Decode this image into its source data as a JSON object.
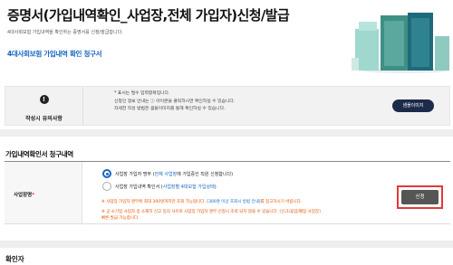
{
  "page": {
    "title": "증명서(가입내역확인_사업장,전체 가입자)신청/발급",
    "subtitle": "4대사회보험 가입내역을 확인하는 증명서를 신청/발급합니다.",
    "link_title": "4대사회보험 가입내역 확인 청구서"
  },
  "notice": {
    "label": "작성시 유의사항",
    "lines": [
      "* 표시는 필수 입력항목입니다.",
      "신청인 정보 안내는 ⓘ 아이콘을 클릭하시면 확인하실 수 있습니다.",
      "자세한 작성 방법은 샘플이미지를 통해 확인하실 수 있습니다."
    ],
    "sample_button": "샘플이미지"
  },
  "section": {
    "title": "가입내역확인서 청구내역",
    "row_label": "사업장명",
    "required_mark": "*",
    "options": [
      {
        "prefix": "사업장 가입자 명부 (",
        "link": "전체 사업장",
        "suffix": "에 가입중인 직원 신청합니다)",
        "selected": true
      },
      {
        "prefix": "사업장 가입내역 확인서 (",
        "link": "사업장별 4대보험 가입상태",
        "suffix": ")",
        "selected": false
      }
    ],
    "warning1_prefix": "※ 사업장 가입자 명부에 최대 300명까지만 조회 가능합니다.  ",
    "warning1_link": "[300명 이상 조회시 방법 안내]",
    "warning1_suffix": "를 참고하시기 바랍니다.",
    "warning2_line1": "※ 공·소기업 사업자 중 소재지 신고 등의 사유로 사업장 가입자 명부 신청시 조회 되지 않을 수 있습니다.  [신규/휴업/폐업 사업장]",
    "warning2_line2": "빠른 발급 가능합니다.",
    "apply_button": "신청"
  },
  "confirm": {
    "title": "확인자"
  },
  "colors": {
    "accent_blue": "#1565c0",
    "warning_orange": "#e65100",
    "highlight_red": "#e53935",
    "dark_button": "#1d2b4a"
  }
}
